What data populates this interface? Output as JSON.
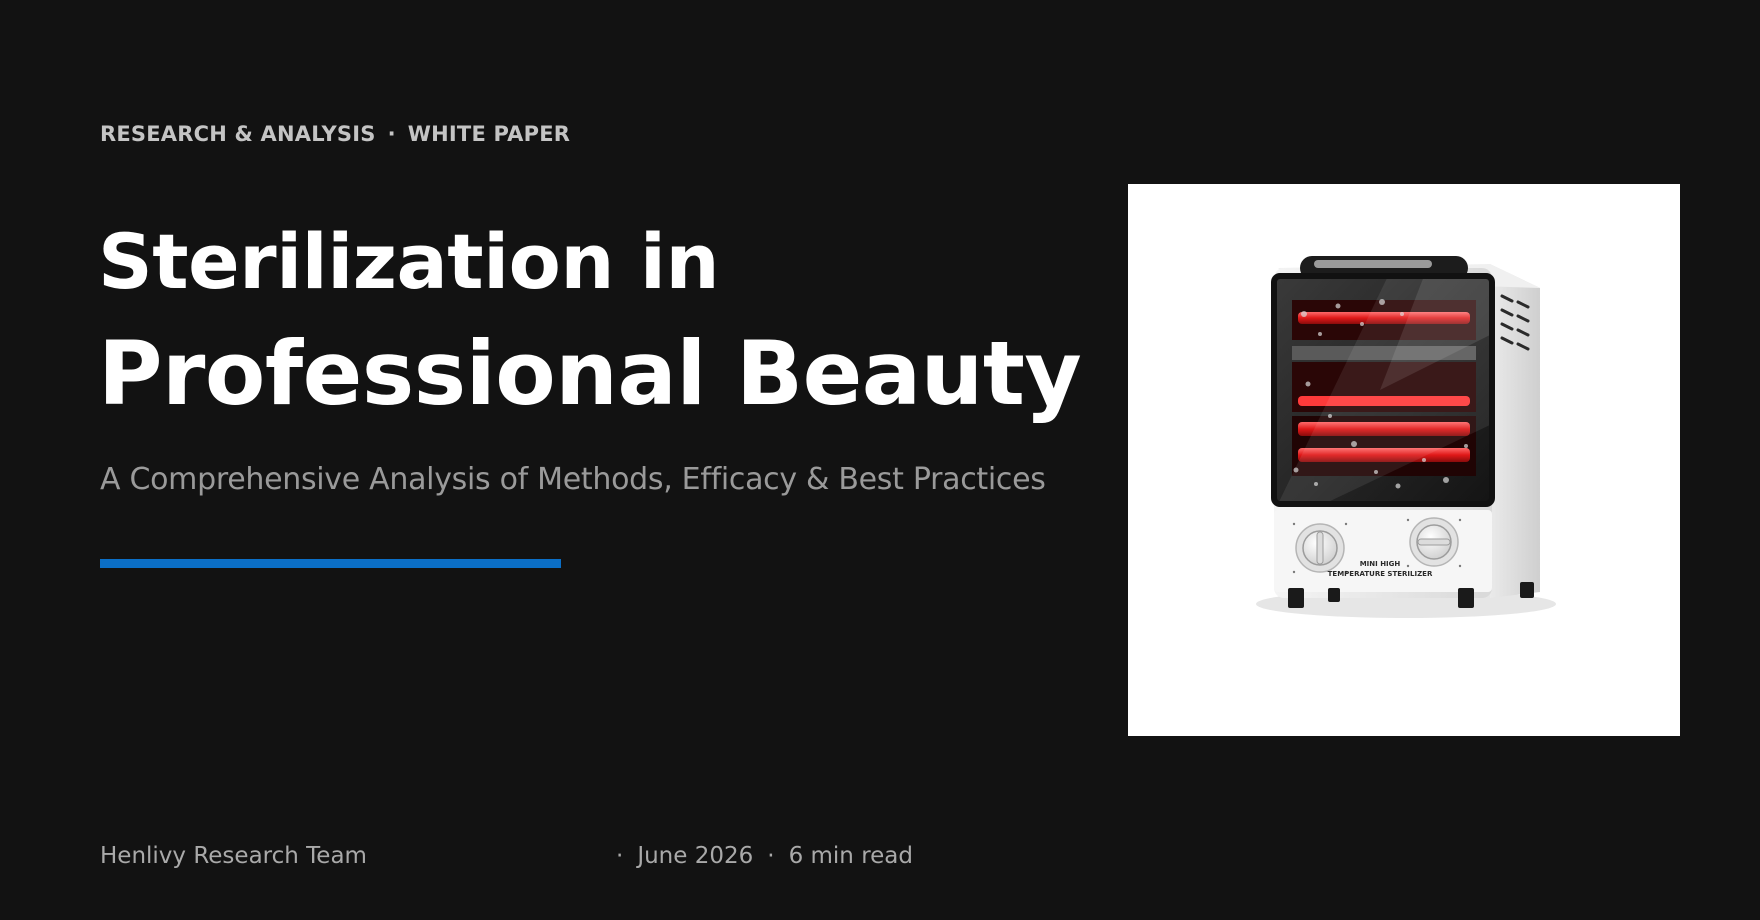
{
  "header": {
    "category": "RESEARCH & ANALYSIS",
    "separator": "·",
    "type": "WHITE PAPER"
  },
  "hero": {
    "title_line1": "Sterilization in",
    "title_line2": "Professional Beauty",
    "subtitle": "A Comprehensive Analysis of Methods, Efficacy & Best Practices"
  },
  "footer": {
    "author": "Henlivy Research Team",
    "separator": "·",
    "date": "June 2026",
    "read_time": "6 min read"
  },
  "product_image": {
    "label_line1": "MINI HIGH",
    "label_line2": "TEMPERATURE STERILIZER"
  },
  "colors": {
    "background": "#121212",
    "accent": "#0b6fc7",
    "title": "#ffffff",
    "muted": "#9a9a9a"
  }
}
